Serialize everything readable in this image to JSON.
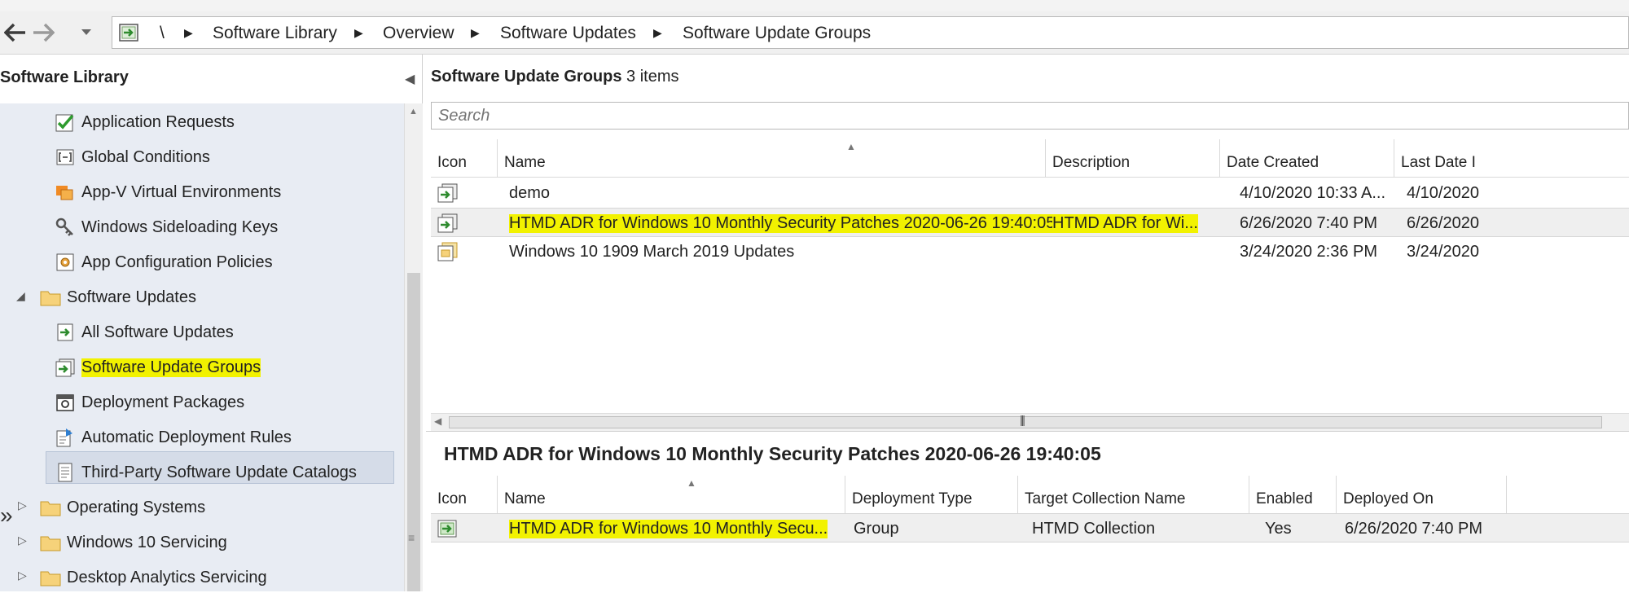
{
  "breadcrumb": {
    "root": "\\",
    "items": [
      "Software Library",
      "Overview",
      "Software Updates",
      "Software Update Groups"
    ]
  },
  "nav": {
    "title": "Software Library",
    "items": [
      {
        "label": "Application Requests",
        "icon": "application-requests-icon"
      },
      {
        "label": "Global Conditions",
        "icon": "global-conditions-icon"
      },
      {
        "label": "App-V Virtual Environments",
        "icon": "appv-icon"
      },
      {
        "label": "Windows Sideloading Keys",
        "icon": "key-icon"
      },
      {
        "label": "App Configuration Policies",
        "icon": "app-config-icon"
      },
      {
        "label": "Software Updates",
        "icon": "folder-icon"
      },
      {
        "label": "All Software Updates",
        "icon": "updates-icon"
      },
      {
        "label": "Software Update Groups",
        "icon": "update-group-icon"
      },
      {
        "label": "Deployment Packages",
        "icon": "package-icon"
      },
      {
        "label": "Automatic Deployment Rules",
        "icon": "adr-icon"
      },
      {
        "label": "Third-Party Software Update Catalogs",
        "icon": "catalog-icon"
      },
      {
        "label": "Operating Systems",
        "icon": "folder-icon"
      },
      {
        "label": "Windows 10 Servicing",
        "icon": "folder-icon"
      },
      {
        "label": "Desktop Analytics Servicing",
        "icon": "folder-icon"
      }
    ]
  },
  "main": {
    "header_title": "Software Update Groups",
    "header_count": "3 items",
    "search_placeholder": "Search",
    "columns": [
      "Icon",
      "Name",
      "Description",
      "Date Created",
      "Last Date I"
    ],
    "rows": [
      {
        "name": "demo",
        "description": "",
        "date_created": "4/10/2020 10:33 A...",
        "last_date": "4/10/2020"
      },
      {
        "name": "HTMD ADR for Windows 10 Monthly Security Patches 2020-06-26 19:40:05",
        "description": "HTMD ADR for Wi...",
        "date_created": "6/26/2020 7:40 PM",
        "last_date": "6/26/2020"
      },
      {
        "name": "Windows 10 1909 March 2019 Updates",
        "description": "",
        "date_created": "3/24/2020 2:36 PM",
        "last_date": "3/24/2020"
      }
    ]
  },
  "details": {
    "title": "HTMD ADR for Windows 10 Monthly Security Patches 2020-06-26 19:40:05",
    "columns": [
      "Icon",
      "Name",
      "Deployment Type",
      "Target Collection Name",
      "Enabled",
      "Deployed On"
    ],
    "rows": [
      {
        "name": "HTMD ADR for Windows 10 Monthly Secu...",
        "deployment_type": "Group",
        "target_collection": "HTMD Collection",
        "enabled": "Yes",
        "deployed_on": "6/26/2020 7:40 PM"
      }
    ]
  },
  "colors": {
    "highlight": "#f2f200",
    "nav_background": "#e8ecf3",
    "selection": "#d5dce8"
  }
}
